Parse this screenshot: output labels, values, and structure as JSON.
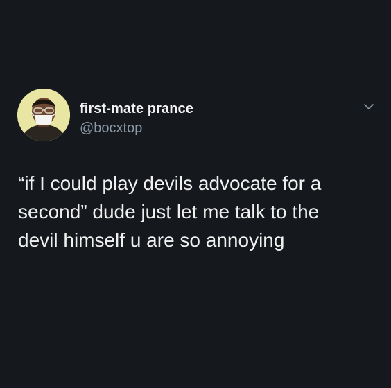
{
  "tweet": {
    "display_name": "first-mate prance",
    "handle": "@bocxtop",
    "text": "“if I could play devils advocate for a\nsecond” dude just let me talk to the\ndevil himself u are so annoying"
  },
  "colors": {
    "background": "#15181d",
    "text_primary": "#f0f0f0",
    "text_secondary": "#8b98a5",
    "avatar_background": "#e9e6a3"
  },
  "icons": {
    "menu": "chevron-down-icon",
    "avatar": "profile-photo"
  }
}
